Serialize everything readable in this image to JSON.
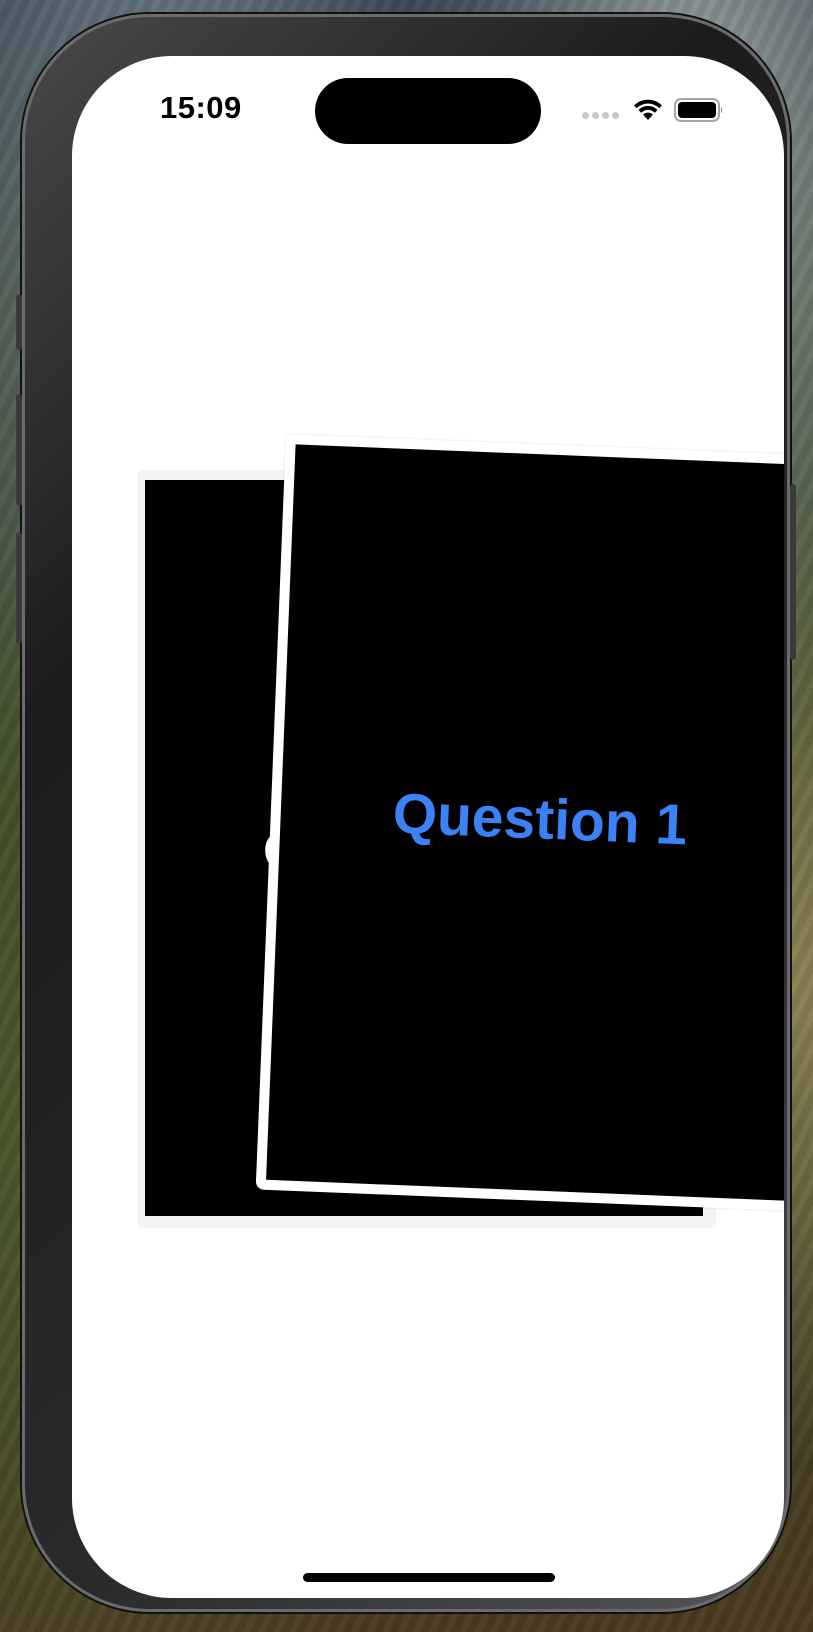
{
  "status_bar": {
    "time": "15:09",
    "signal_icon": "cellular-signal-icon",
    "wifi_icon": "wifi-icon",
    "battery_icon": "battery-icon"
  },
  "cards": {
    "front": {
      "label": "Question 1",
      "label_color": "#3a82f6",
      "background": "#000000",
      "border_color": "#ffffff"
    },
    "back": {
      "label": "Q",
      "label_color": "#ffffff",
      "background": "#000000"
    }
  },
  "colors": {
    "screen_background": "#ffffff",
    "accent": "#3a82f6"
  }
}
